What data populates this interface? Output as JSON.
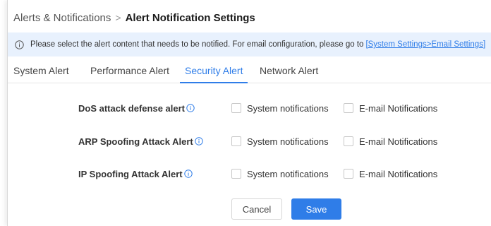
{
  "header": {
    "parent": "Alerts & Notifications",
    "separator": ">",
    "current": "Alert Notification Settings"
  },
  "info_bar": {
    "icon": "info-icon",
    "text": "Please select the alert content that needs to be notified. For email configuration, please go to",
    "link": "[System Settings>Email Settings]"
  },
  "tabs": [
    {
      "label": "System Alert",
      "active": false
    },
    {
      "label": "Performance Alert",
      "active": false
    },
    {
      "label": "Security Alert",
      "active": true
    },
    {
      "label": "Network Alert",
      "active": false
    }
  ],
  "alerts": [
    {
      "label": "DoS attack defense alert",
      "system_label": "System notifications",
      "system_checked": false,
      "email_label": "E-mail Notifications",
      "email_checked": false
    },
    {
      "label": "ARP Spoofing Attack Alert",
      "system_label": "System notifications",
      "system_checked": false,
      "email_label": "E-mail Notifications",
      "email_checked": false
    },
    {
      "label": "IP Spoofing Attack Alert",
      "system_label": "System notifications",
      "system_checked": false,
      "email_label": "E-mail Notifications",
      "email_checked": false
    }
  ],
  "buttons": {
    "cancel": "Cancel",
    "save": "Save"
  },
  "colors": {
    "accent": "#2f7de8",
    "info_bg": "#e8f1fd"
  }
}
